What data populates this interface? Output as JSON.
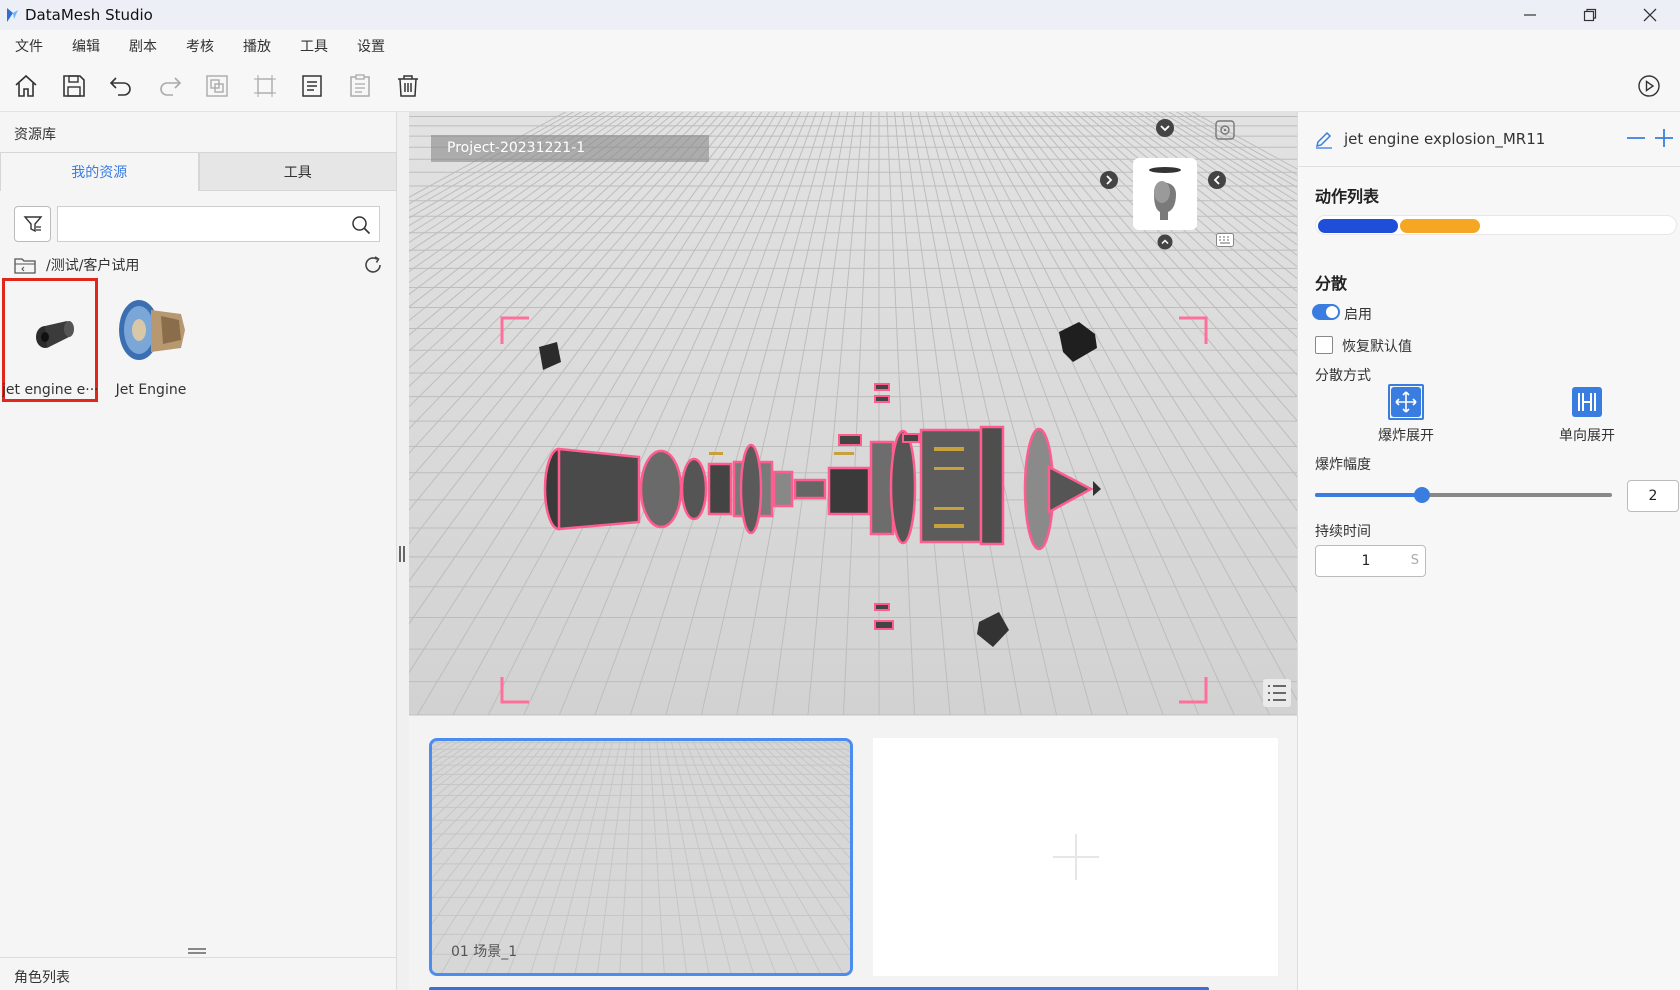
{
  "app": {
    "title": "DataMesh Studio"
  },
  "menu": [
    "文件",
    "编辑",
    "剧本",
    "考核",
    "播放",
    "工具",
    "设置"
  ],
  "toolbar": {
    "icons": [
      "home-icon",
      "save-icon",
      "undo-icon",
      "redo-icon",
      "duplicate-icon",
      "align-icon",
      "copy-icon",
      "paste-icon",
      "delete-icon"
    ],
    "play_icon": "play-icon"
  },
  "left_panel": {
    "title": "资源库",
    "tabs": [
      {
        "label": "我的资源",
        "active": true
      },
      {
        "label": "工具",
        "active": false
      }
    ],
    "search": {
      "placeholder": "",
      "value": ""
    },
    "path": "/测试/客户试用",
    "assets": [
      {
        "label": "jet engine e···",
        "selected": true
      },
      {
        "label": "Jet Engine",
        "selected": false
      }
    ],
    "roles_title": "角色列表"
  },
  "viewport": {
    "project_label": "Project-20231221-1"
  },
  "scenes": {
    "items": [
      {
        "label": "01  场景_1",
        "selected": true
      }
    ]
  },
  "right_panel": {
    "title": "jet engine explosion_MR11",
    "action_list_title": "动作列表",
    "disperse_title": "分散",
    "enable_label": "启用",
    "enable_on": true,
    "restore_label": "恢复默认值",
    "restore_checked": false,
    "mode_label": "分散方式",
    "modes": [
      {
        "label": "爆炸展开",
        "selected": true
      },
      {
        "label": "单向展开",
        "selected": false
      }
    ],
    "amplitude_label": "爆炸幅度",
    "amplitude_value": "2",
    "amplitude_fraction": 0.36,
    "duration_label": "持续时间",
    "duration_value": "1",
    "duration_unit": "S"
  },
  "colors": {
    "accent": "#3a7de0",
    "selection_red": "#e1261c",
    "highlight_pink": "#ff6f9c",
    "action_blue": "#1f4fd8",
    "action_orange": "#f5a623"
  }
}
